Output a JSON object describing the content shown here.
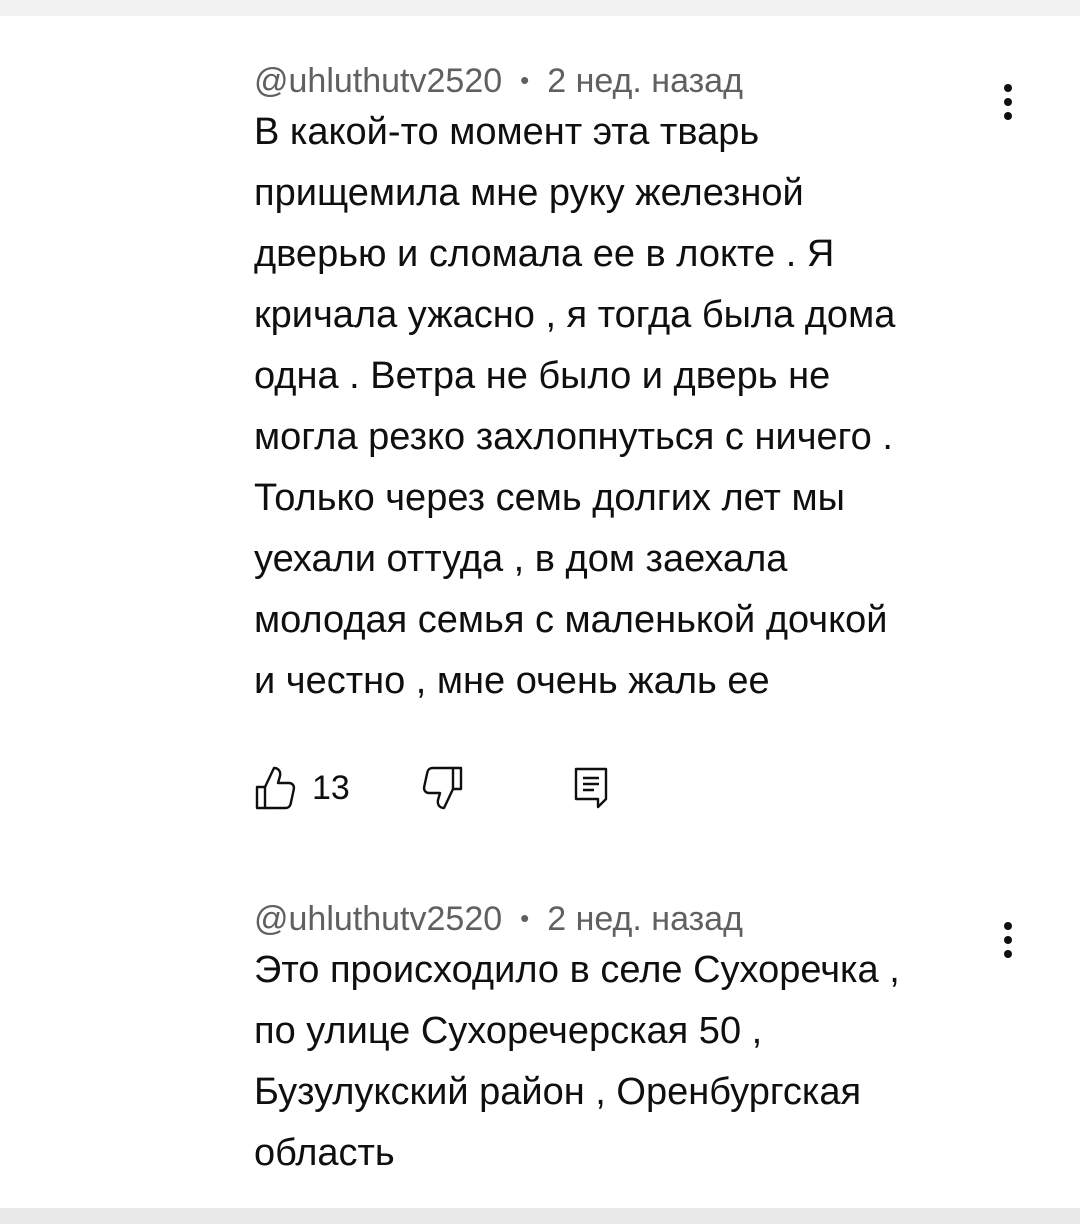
{
  "comments": [
    {
      "author": "@uhluthutv2520",
      "separator": "•",
      "time": "2 нед. назад",
      "lines": [
        "В какой-то момент эта тварь",
        "прищемила мне руку железной",
        "дверью и сломала ее в локте . Я",
        "кричала ужасно , я тогда была дома",
        "одна . Ветра не было и дверь не",
        "могла резко захлопнуться с ничего .",
        "Только через семь долгих лет мы",
        "уехали оттуда , в дом заехала",
        "молодая семья с маленькой дочкой",
        "и честно , мне очень жаль ее"
      ],
      "likes": "13",
      "icons": {
        "like": "thumb-up-icon",
        "dislike": "thumb-down-icon",
        "reply": "reply-comment-icon",
        "menu": "more-vertical-icon"
      }
    },
    {
      "author": "@uhluthutv2520",
      "separator": "•",
      "time": "2 нед. назад",
      "lines": [
        "Это происходило в селе Сухоречка ,",
        "по улице Сухоречерская 50 ,",
        "Бузулукский район , Оренбургская",
        "область"
      ],
      "icons": {
        "menu": "more-vertical-icon"
      }
    }
  ],
  "colors": {
    "text": "#0f0f0f",
    "meta": "#606060",
    "background": "#ffffff",
    "page_edge": "#f2f2f2"
  }
}
